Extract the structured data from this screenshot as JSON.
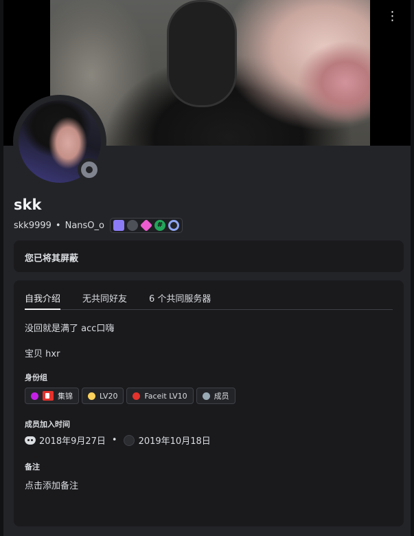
{
  "profile": {
    "display_name": "skk",
    "username": "skk9999",
    "separator": "•",
    "pronouns": "NansO_o",
    "badges": [
      "nitro-badge",
      "boost-badge",
      "hypesquad-badge",
      "hashtag-badge",
      "ring-badge"
    ],
    "badge_hash": "#"
  },
  "header": {
    "more_label": "⋮"
  },
  "blocked": {
    "text": "您已将其屏蔽"
  },
  "tabs": [
    {
      "label": "自我介绍"
    },
    {
      "label": "无共同好友"
    },
    {
      "label": "6 个共同服务器"
    }
  ],
  "bio": {
    "line1": "没回就是满了 acc口嗨",
    "line2": "宝贝 hxr"
  },
  "roles_section": {
    "title": "身份组",
    "roles": [
      {
        "label": "集锦",
        "color": "#c521e6"
      },
      {
        "label": "LV20",
        "color": "#fcd25c"
      },
      {
        "label": "Faceit LV10",
        "color": "#e5322c"
      },
      {
        "label": "成员",
        "color": "#99aab5"
      }
    ]
  },
  "member_since": {
    "title": "成员加入时间",
    "discord_date": "2018年9月27日",
    "separator": "•",
    "server_date": "2019年10月18日"
  },
  "note": {
    "title": "备注",
    "placeholder": "点击添加备注"
  }
}
